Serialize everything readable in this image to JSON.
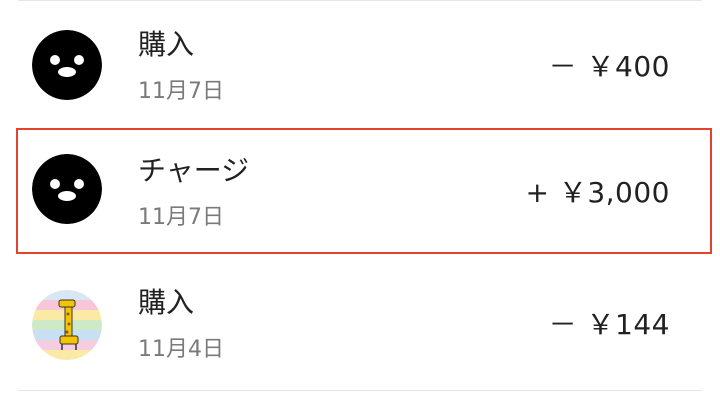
{
  "transactions": [
    {
      "title": "購入",
      "date": "11月7日",
      "amount": "－ ￥400",
      "icon": "penguin-icon"
    },
    {
      "title": "チャージ",
      "date": "11月7日",
      "amount": "+ ￥3,000",
      "icon": "penguin-icon",
      "highlighted": true
    },
    {
      "title": "購入",
      "date": "11月4日",
      "amount": "－ ￥144",
      "icon": "giraffe-icon"
    }
  ],
  "colors": {
    "highlight_border": "#e5412d",
    "text_primary": "#212121",
    "text_secondary": "#7a7a7a",
    "divider": "#e6e6e6"
  }
}
